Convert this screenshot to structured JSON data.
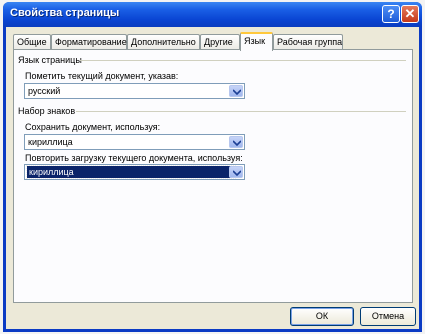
{
  "dialog": {
    "title": "Свойства страницы"
  },
  "titlebar_buttons": {
    "help": "?",
    "close": "✕"
  },
  "tabs": [
    {
      "label": "Общие"
    },
    {
      "label": "Форматирование"
    },
    {
      "label": "Дополнительно"
    },
    {
      "label": "Другие"
    },
    {
      "label": "Язык",
      "active": true
    },
    {
      "label": "Рабочая группа"
    }
  ],
  "page_language": {
    "group_label": "Язык страницы",
    "mark_label": "Пометить текущий документ, указав:",
    "mark_value": "русский"
  },
  "charset": {
    "group_label": "Набор знаков",
    "save_label": "Сохранить документ, используя:",
    "save_value": "кириллица",
    "reload_label": "Повторить загрузку текущего документа, используя:",
    "reload_value": "кириллица"
  },
  "footer": {
    "ok_label": "ОК",
    "cancel_label": "Отмена"
  },
  "colors": {
    "titlebar": "#0a45d3",
    "active_tab_accent": "#ffc83c",
    "selection": "#0a246a"
  }
}
